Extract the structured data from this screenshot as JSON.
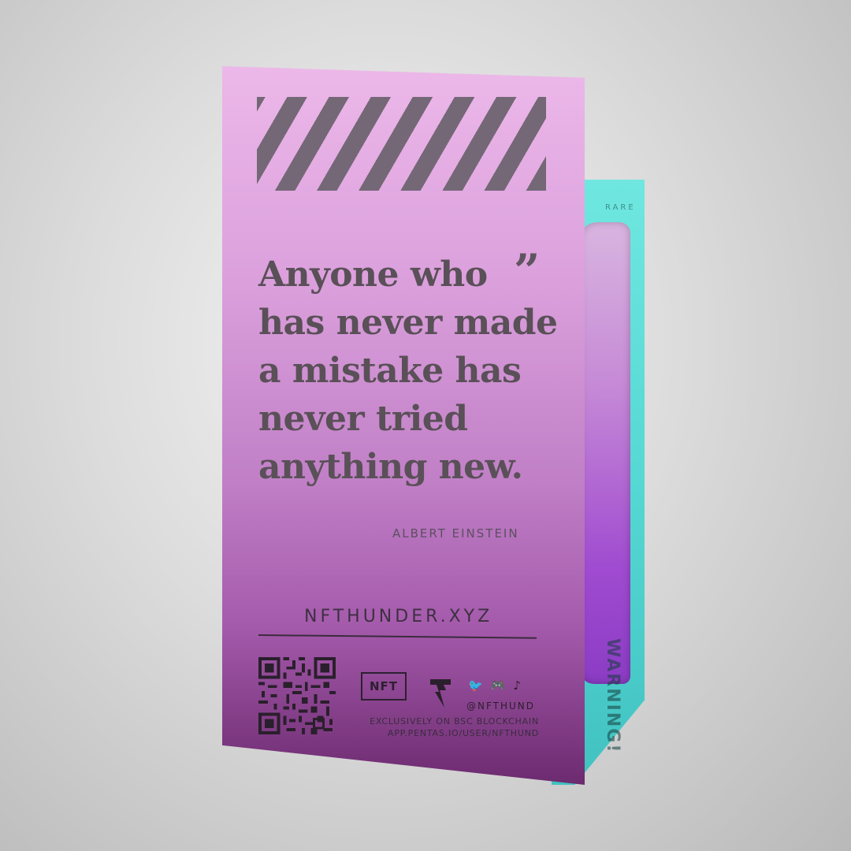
{
  "packaging": {
    "quote_lines": [
      "Anyone who",
      "has never made",
      "a mistake has",
      "never tried",
      "anything new."
    ],
    "quote_mark": "”",
    "author": "ALBERT EINSTEIN",
    "website": "NFTHUNDER.XYZ",
    "nft_badge": "NFT",
    "brand_logo_letter": "T",
    "social_icons": [
      "twitter-icon",
      "discord-icon",
      "tiktok-icon"
    ],
    "social_handle": "@NFTHUND",
    "exclusive_line1": "EXCLUSIVELY ON BSC BLOCKCHAIN",
    "exclusive_line2": "APP.PENTAS.IO/USER/NFTHUND",
    "side_top_label": "RARE",
    "side_warning": "WARNING!"
  },
  "colors": {
    "front_panel_top": "#ecb8e9",
    "front_panel_bottom": "#6c2a6f",
    "side_panel": "#53d6d2",
    "side_window": "#a04bd0",
    "text_dark": "#5a5058",
    "background": "#dcdcdc"
  }
}
